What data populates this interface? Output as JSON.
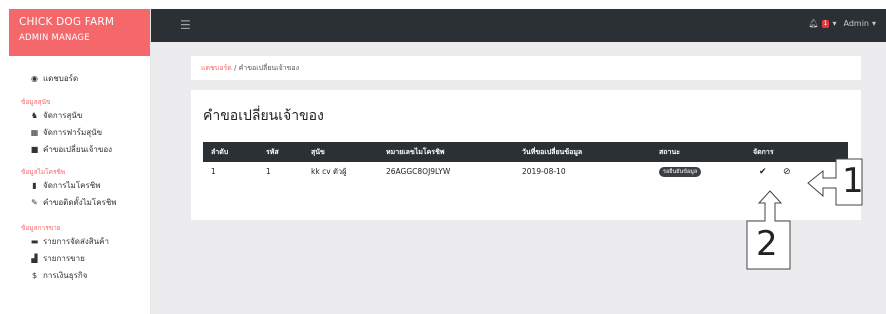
{
  "brand": {
    "title": "CHICK DOG FARM",
    "subtitle": "ADMIN MANAGE"
  },
  "sidebar": {
    "dashboard": "แดชบอร์ด",
    "groups": [
      {
        "heading": "ข้อมูลสุนัข",
        "items": [
          "จัดการสุนัข",
          "จัดการฟาร์มสุนัข",
          "คำขอเปลี่ยนเจ้าของ"
        ]
      },
      {
        "heading": "ข้อมูลไมโครชิพ",
        "items": [
          "จัดการไมโครชิพ",
          "คำขอติดตั้งไมโครชิพ"
        ]
      },
      {
        "heading": "ข้อมูลการขาย",
        "items": [
          "รายการจัดส่งสินค้า",
          "รายการขาย",
          "การเงินธุรกิจ"
        ]
      }
    ]
  },
  "topbar": {
    "notif_count": "1",
    "user": "Admin"
  },
  "breadcrumb": {
    "home": "แดชบอร์ด",
    "sep": "/",
    "current": "คำขอเปลี่ยนเจ้าของ"
  },
  "card": {
    "title": "คำขอเปลี่ยนเจ้าของ"
  },
  "table": {
    "headers": [
      "ลำดับ",
      "รหัส",
      "สุนัข",
      "หมายเลขไมโครชิพ",
      "วันที่ขอเปลี่ยนข้อมูล",
      "สถานะ",
      "จัดการ"
    ],
    "rows": [
      {
        "no": "1",
        "id": "1",
        "dog": "kk cv ตัวผู้",
        "chip": "26AGGC8OJ9LYW",
        "date": "2019-08-10",
        "status": "รอยืนยันข้อมูล"
      }
    ]
  },
  "callouts": {
    "one": "1",
    "two": "2"
  }
}
